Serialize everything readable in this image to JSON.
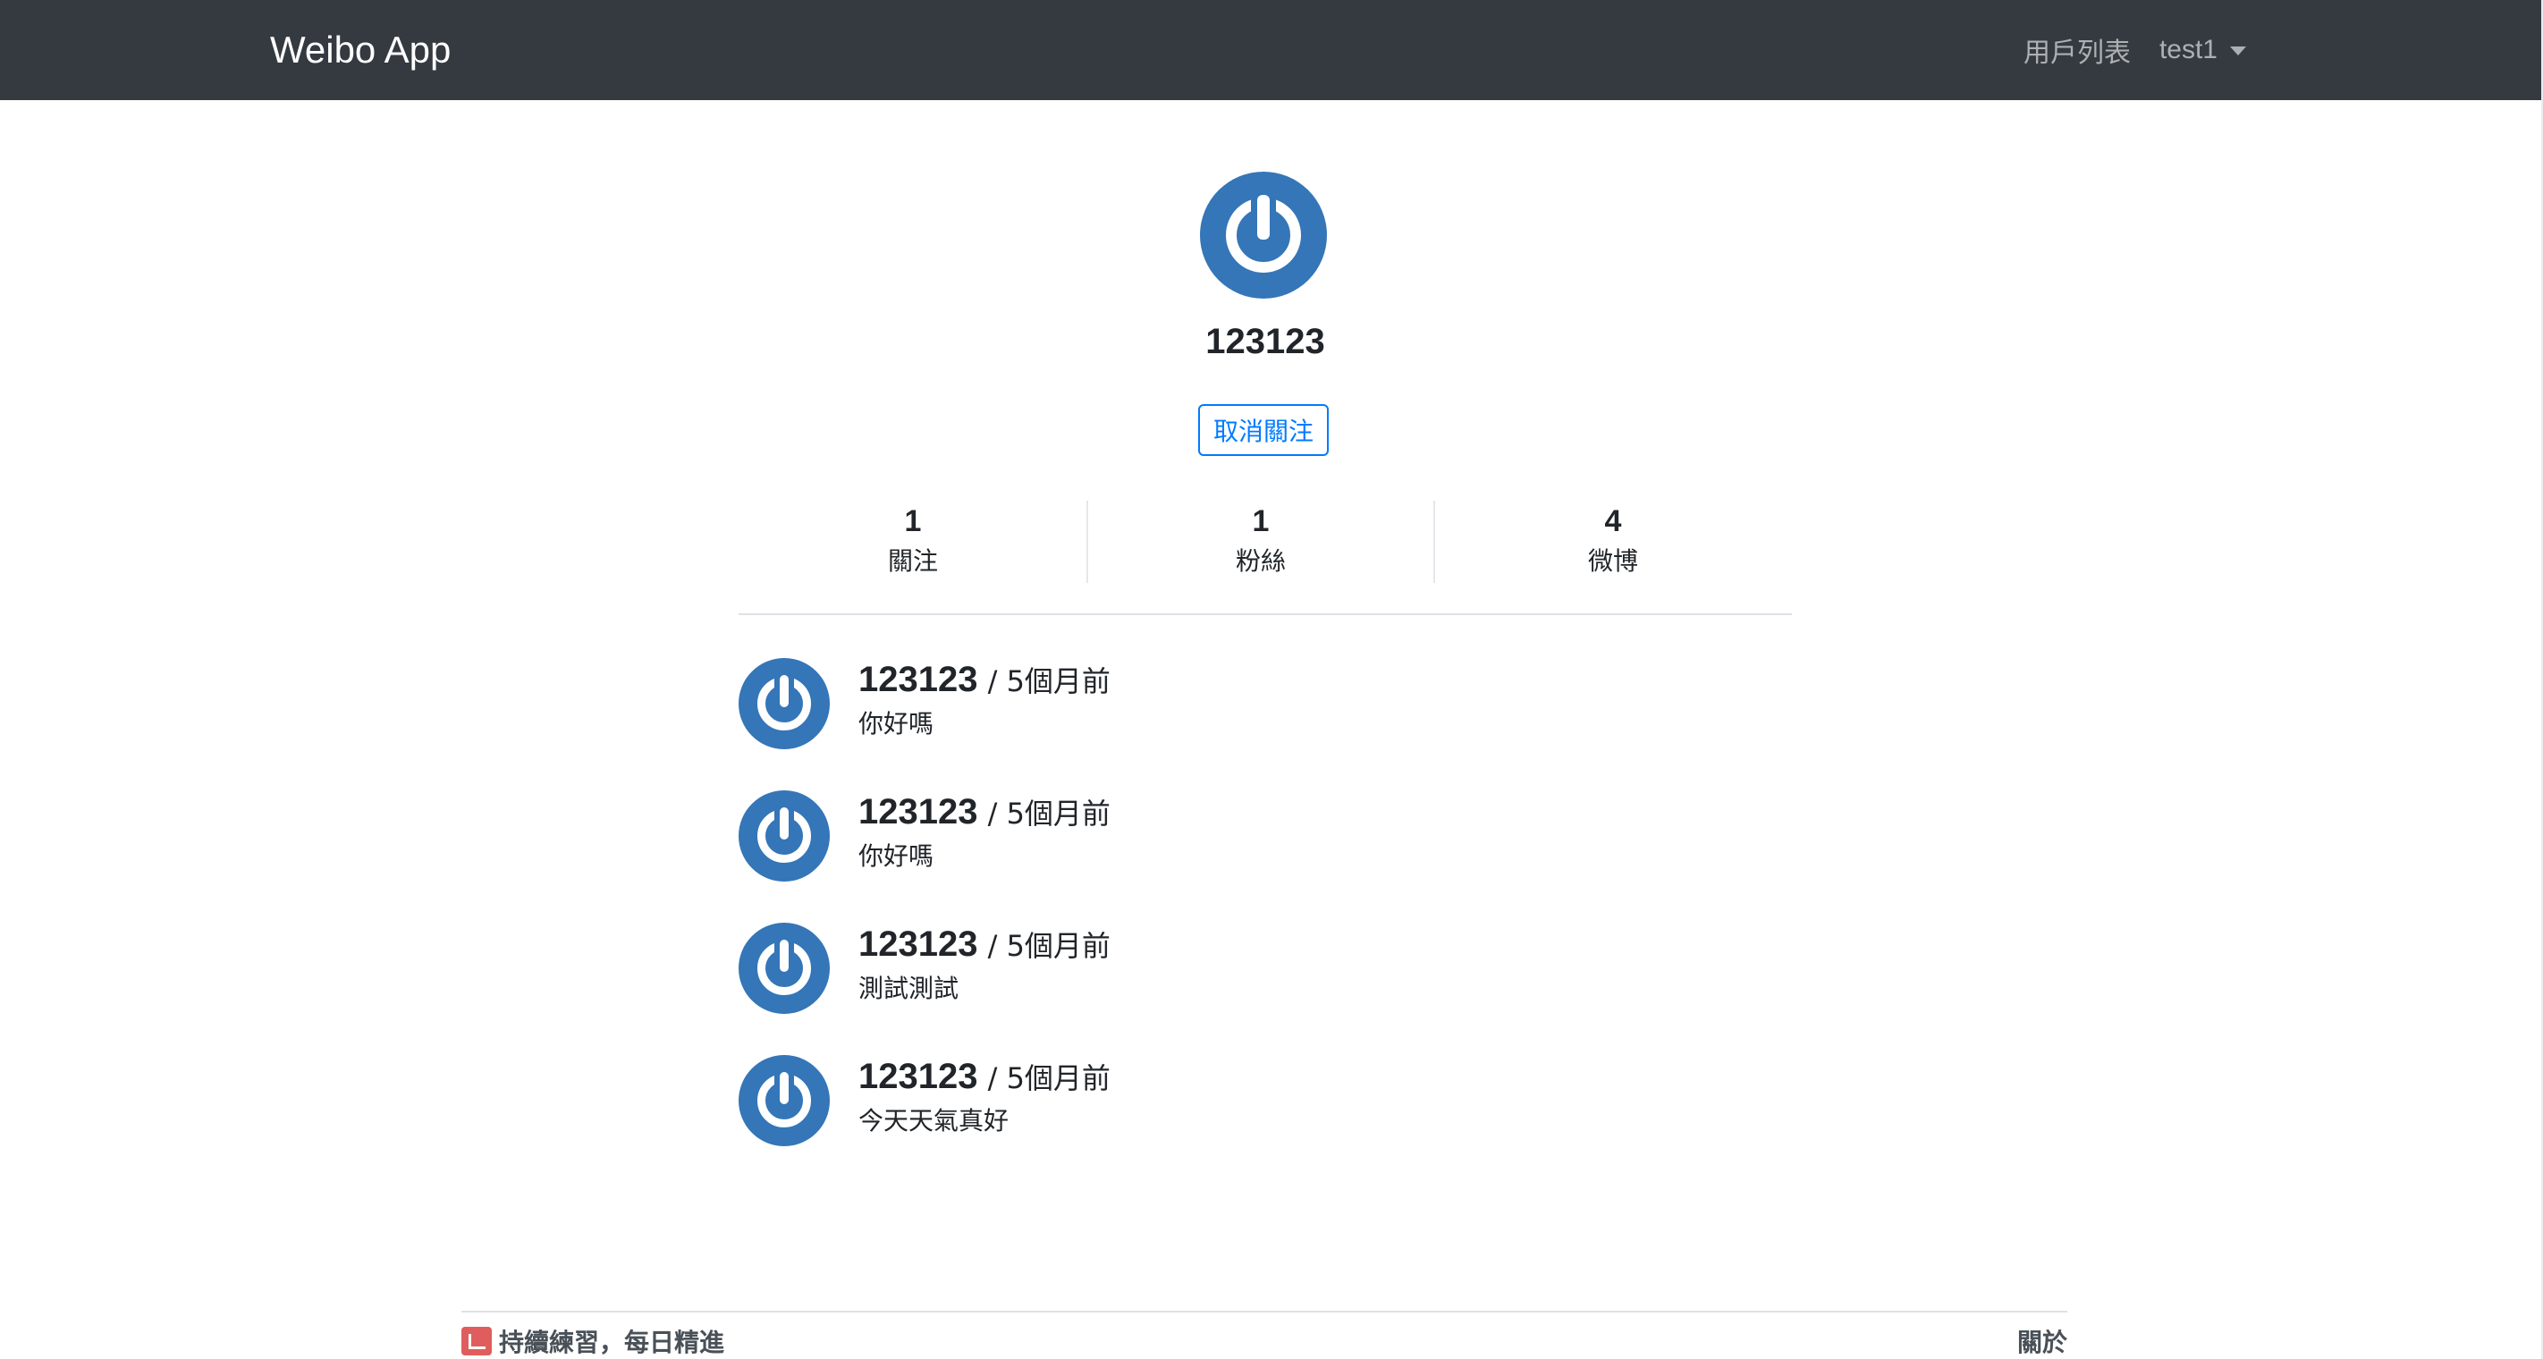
{
  "navbar": {
    "brand": "Weibo App",
    "links": [
      {
        "label": "用戶列表"
      },
      {
        "label": "test1"
      }
    ],
    "bg_color": "#343a40"
  },
  "profile": {
    "avatar_icon": "power-icon",
    "name": "123123",
    "follow_button_label": "取消關注",
    "stats": [
      {
        "value": "1",
        "label": "關注"
      },
      {
        "value": "1",
        "label": "粉絲"
      },
      {
        "value": "4",
        "label": "微博"
      }
    ]
  },
  "feed": {
    "items": [
      {
        "author": "123123",
        "time": "/ 5個月前",
        "content": "你好嗎"
      },
      {
        "author": "123123",
        "time": "/ 5個月前",
        "content": "你好嗎"
      },
      {
        "author": "123123",
        "time": "/ 5個月前",
        "content": "測試測試"
      },
      {
        "author": "123123",
        "time": "/ 5個月前",
        "content": "今天天氣真好"
      }
    ]
  },
  "footer": {
    "slogan": "持續練習，每日精進",
    "about_link": "關於"
  },
  "colors": {
    "accent": "#007bff",
    "avatar_blue": "#3476b8"
  }
}
